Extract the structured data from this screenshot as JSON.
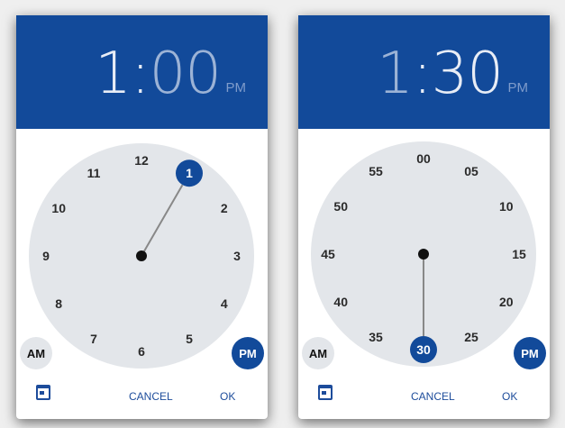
{
  "pickers": [
    {
      "hour": "1",
      "sep": ":",
      "minute": "00",
      "period": "PM",
      "active": "hour",
      "labels": [
        "12",
        "1",
        "2",
        "3",
        "4",
        "5",
        "6",
        "7",
        "8",
        "9",
        "10",
        "11"
      ],
      "selected_index": 1,
      "am_label": "AM",
      "pm_label": "PM",
      "selected_period": "PM",
      "cancel": "CANCEL",
      "ok": "OK"
    },
    {
      "hour": "1",
      "sep": ":",
      "minute": "30",
      "period": "PM",
      "active": "minute",
      "labels": [
        "00",
        "05",
        "10",
        "15",
        "20",
        "25",
        "30",
        "35",
        "40",
        "45",
        "50",
        "55"
      ],
      "selected_index": 6,
      "am_label": "AM",
      "pm_label": "PM",
      "selected_period": "PM",
      "cancel": "CANCEL",
      "ok": "OK"
    }
  ],
  "colors": {
    "header": "#124a9a",
    "face": "#e3e6ea",
    "accent": "#124a9a"
  }
}
